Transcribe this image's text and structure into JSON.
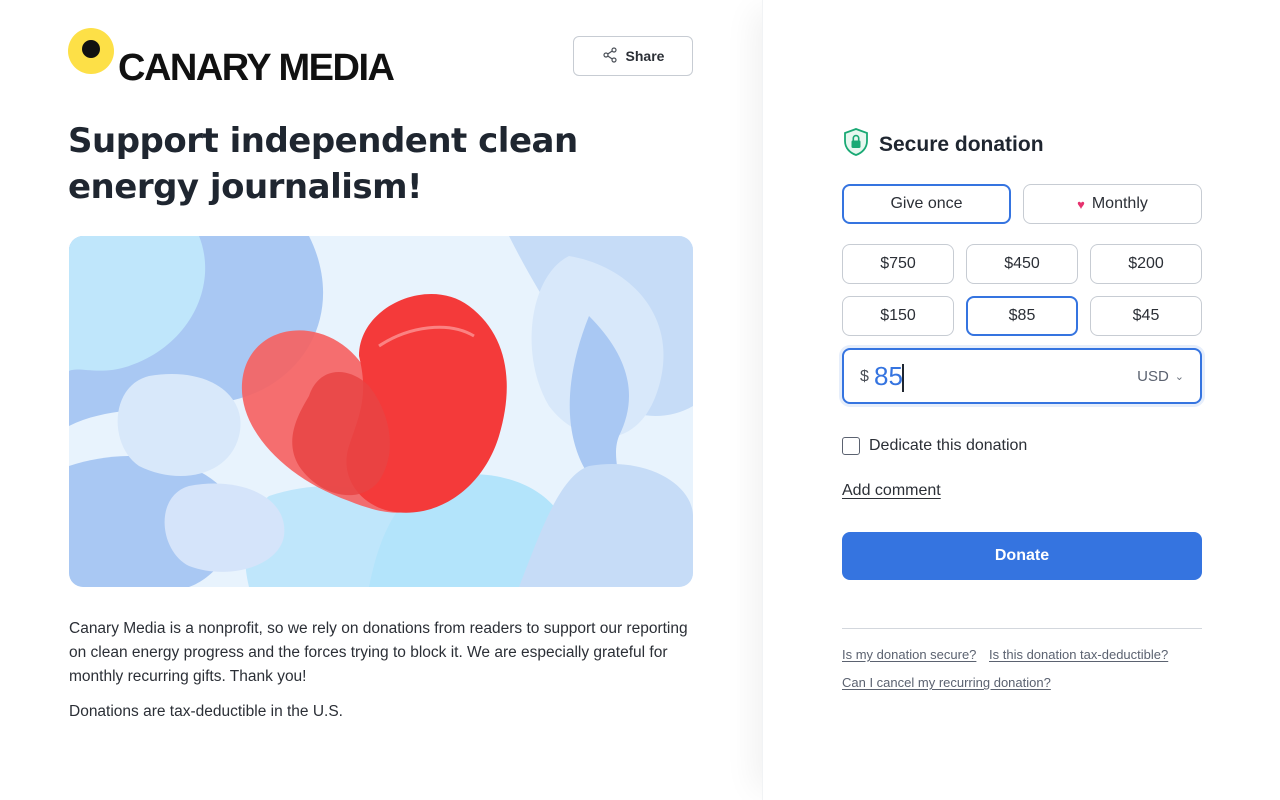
{
  "brand": {
    "name": "CANARY MEDIA",
    "logo_color": "#fde047"
  },
  "share": {
    "label": "Share",
    "icon": "share-icon"
  },
  "headline": "Support independent clean energy journalism!",
  "hero": {
    "icon": "heart-illustration"
  },
  "description": {
    "paragraph1": "Canary Media is a nonprofit, so we rely on donations from readers to support our reporting on clean energy progress and the forces trying to block it. We are especially grateful for monthly recurring gifts. Thank you!",
    "paragraph2": "Donations are tax-deductible in the U.S."
  },
  "donation": {
    "title": "Secure donation",
    "icon": "shield-lock-icon",
    "frequency": {
      "once": "Give once",
      "monthly": "Monthly",
      "selected": "once",
      "monthly_icon": "heart-icon"
    },
    "amounts": [
      "$750",
      "$450",
      "$200",
      "$150",
      "$85",
      "$45"
    ],
    "selected_amount": "$85",
    "input": {
      "currency_symbol": "$",
      "value": "85",
      "currency": "USD"
    },
    "dedicate_label": "Dedicate this donation",
    "add_comment": "Add comment",
    "donate_button": "Donate",
    "faq": [
      "Is my donation secure?",
      "Is this donation tax-deductible?",
      "Can I cancel my recurring donation?"
    ]
  },
  "colors": {
    "accent": "#3574e0",
    "heart": "#e6326e",
    "shield": "#19a974"
  }
}
